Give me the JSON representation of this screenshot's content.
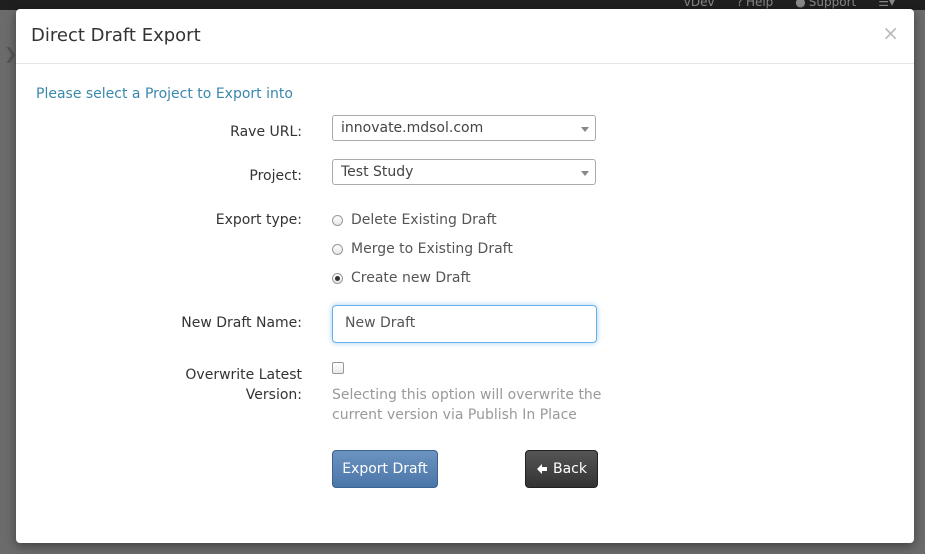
{
  "topbar": {
    "env_label": "vDev",
    "help_label": "Help",
    "support_label": "Support"
  },
  "modal": {
    "title": "Direct Draft Export",
    "close_symbol": "×"
  },
  "form": {
    "intro": "Please select a Project to Export into",
    "rave_url": {
      "label": "Rave URL:",
      "value": "innovate.mdsol.com"
    },
    "project": {
      "label": "Project:",
      "value": "Test Study"
    },
    "export_type": {
      "label": "Export type:",
      "options": [
        {
          "label": "Delete Existing Draft",
          "checked": false
        },
        {
          "label": "Merge to Existing Draft",
          "checked": false
        },
        {
          "label": "Create new Draft",
          "checked": true
        }
      ]
    },
    "new_draft_name": {
      "label": "New Draft Name:",
      "value": "New Draft"
    },
    "overwrite": {
      "label_line1": "Overwrite Latest",
      "label_line2": "Version:",
      "checked": false,
      "help_line1": "Selecting this option will overwrite the",
      "help_line2": "current version via Publish In Place"
    }
  },
  "buttons": {
    "export_label": "Export Draft",
    "back_label": "Back"
  },
  "colors": {
    "info_text": "#3a87ad",
    "primary_button": "#4a76a8",
    "dark_button": "#333333",
    "focus_border": "#66afe9"
  }
}
